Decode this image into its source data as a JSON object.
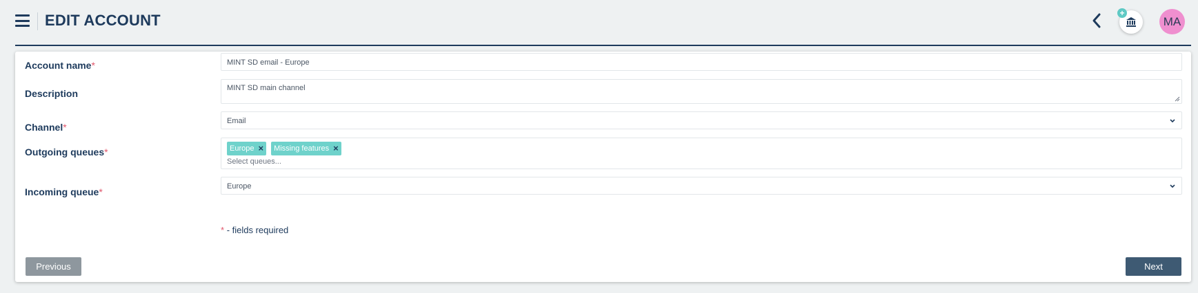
{
  "header": {
    "title": "EDIT ACCOUNT",
    "icons": {
      "menu": "hamburger-icon",
      "back": "chevron-left-icon",
      "bank": "bank-icon",
      "add": "plus-icon"
    },
    "add_badge": "+",
    "avatar_initials": "MA",
    "avatar_color": "#ef8fcf"
  },
  "form": {
    "required_mark": "*",
    "account_name": {
      "label": "Account name",
      "value": "MINT SD email - Europe"
    },
    "description": {
      "label": "Description",
      "value": "MINT SD main channel"
    },
    "channel": {
      "label": "Channel",
      "value": "Email"
    },
    "outgoing_queues": {
      "label": "Outgoing queues",
      "tags": [
        "Europe",
        "Missing features"
      ],
      "remove_glyph": "×",
      "placeholder": "Select queues..."
    },
    "incoming_queue": {
      "label": "Incoming queue",
      "value": "Europe"
    },
    "required_note": "- fields required"
  },
  "buttons": {
    "previous": "Previous",
    "next": "Next"
  },
  "colors": {
    "primary": "#1d3a5c",
    "tag": "#6fd2cb",
    "required": "#e0566b",
    "next": "#3e5a73",
    "previous": "#8e979e"
  }
}
